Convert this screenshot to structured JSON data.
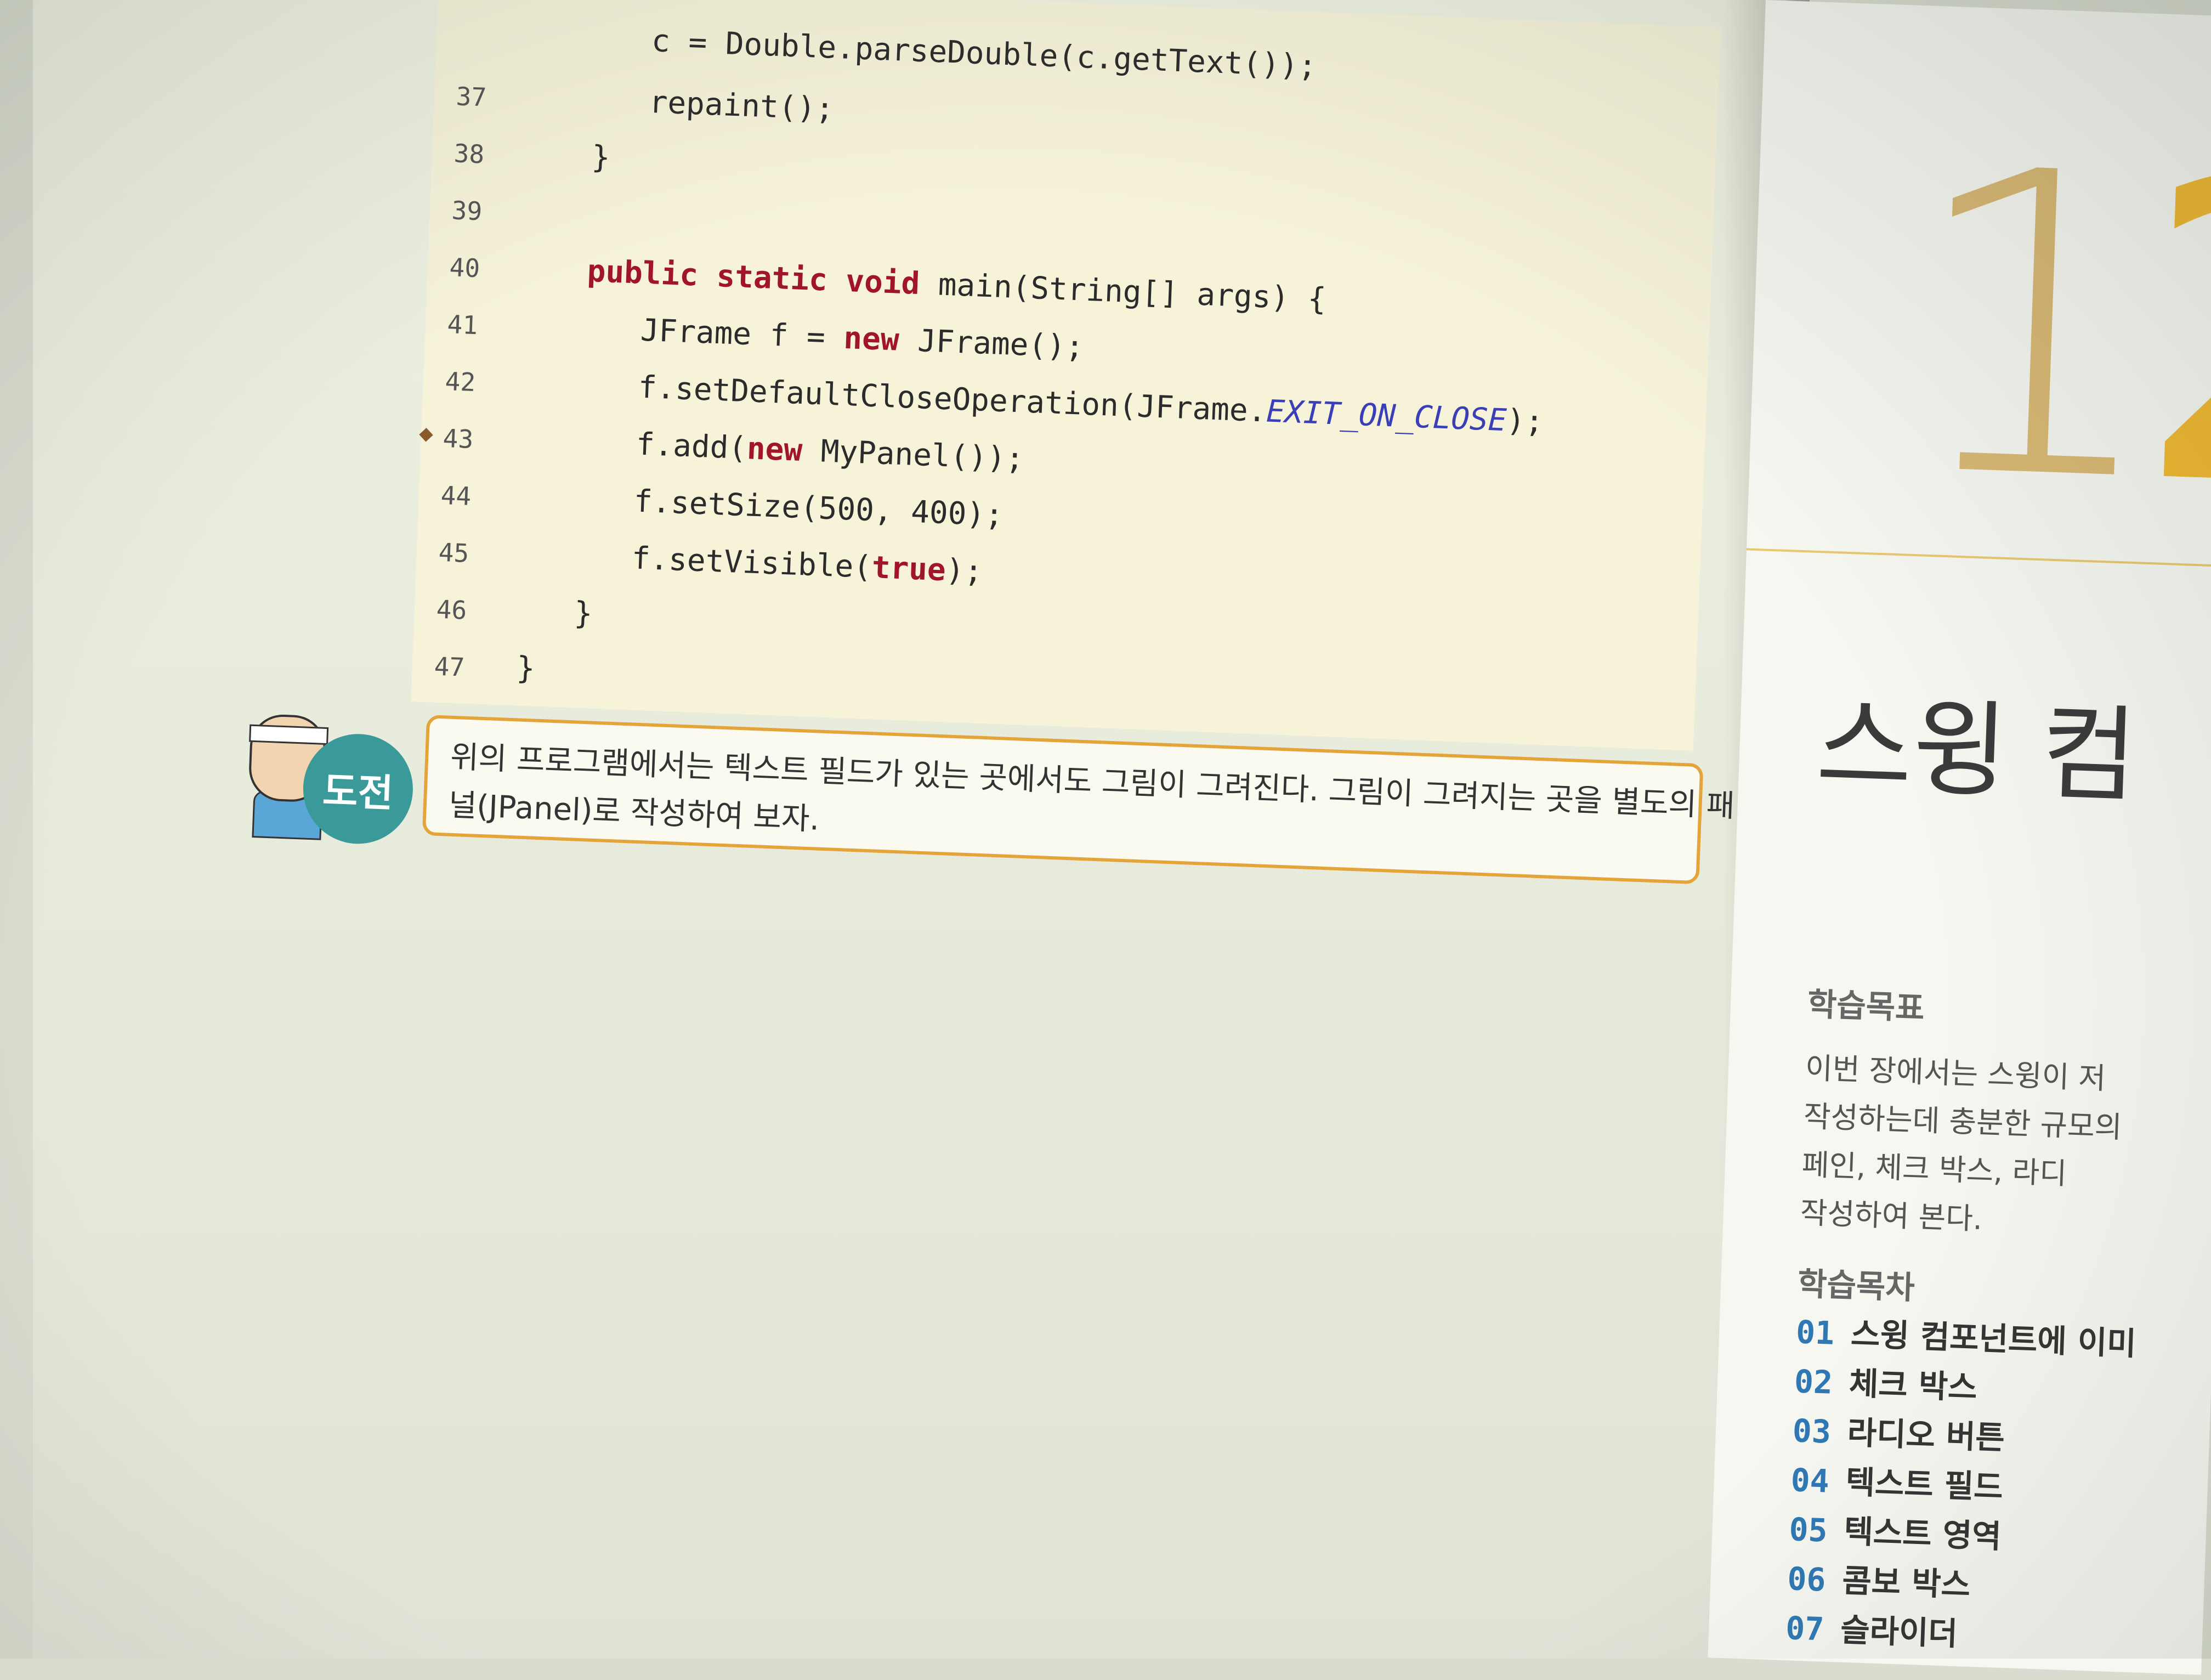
{
  "code": {
    "top_partial": "c = Double.parseDouble(c.getText());",
    "lines": [
      {
        "n": "37",
        "indent": "      ",
        "parts": [
          {
            "t": "repaint();",
            "c": ""
          }
        ]
      },
      {
        "n": "38",
        "indent": "   ",
        "parts": [
          {
            "t": "}",
            "c": ""
          }
        ]
      },
      {
        "n": "39",
        "indent": "",
        "parts": []
      },
      {
        "n": "40",
        "indent": "   ",
        "parts": [
          {
            "t": "public static void",
            "c": "kw"
          },
          {
            "t": " main(String[] args) {",
            "c": ""
          }
        ]
      },
      {
        "n": "41",
        "indent": "      ",
        "parts": [
          {
            "t": "JFrame f = ",
            "c": ""
          },
          {
            "t": "new",
            "c": "kw"
          },
          {
            "t": " JFrame();",
            "c": ""
          }
        ]
      },
      {
        "n": "42",
        "indent": "      ",
        "parts": [
          {
            "t": "f.setDefaultCloseOperation(JFrame.",
            "c": ""
          },
          {
            "t": "EXIT_ON_CLOSE",
            "c": "fld"
          },
          {
            "t": ");",
            "c": ""
          }
        ]
      },
      {
        "n": "43",
        "indent": "      ",
        "parts": [
          {
            "t": "f.add(",
            "c": ""
          },
          {
            "t": "new",
            "c": "kw"
          },
          {
            "t": " MyPanel());",
            "c": ""
          }
        ],
        "breakpoint": true
      },
      {
        "n": "44",
        "indent": "      ",
        "parts": [
          {
            "t": "f.setSize(500, 400);",
            "c": ""
          }
        ]
      },
      {
        "n": "45",
        "indent": "      ",
        "parts": [
          {
            "t": "f.setVisible(",
            "c": ""
          },
          {
            "t": "true",
            "c": "kw"
          },
          {
            "t": ");",
            "c": ""
          }
        ]
      },
      {
        "n": "46",
        "indent": "   ",
        "parts": [
          {
            "t": "}",
            "c": ""
          }
        ]
      },
      {
        "n": "47",
        "indent": "",
        "parts": [
          {
            "t": "}",
            "c": ""
          }
        ]
      }
    ]
  },
  "challenge": {
    "badge": "도전",
    "text_line1": "위의 프로그램에서는 텍스트 필드가 있는 곳에서도 그림이 그려진다. 그림이 그려지는 곳을 별도의 패",
    "text_line2": "널(JPanel)로 작성하여 보자."
  },
  "right_page": {
    "chapter_number": "1",
    "chapter_number_partial": "2",
    "chapter_title": "스윙 컴",
    "objectives_heading": "학습목표",
    "objectives_text": "이번 장에서는 스윙이 저\n작성하는데 충분한 규모의\n페인, 체크 박스, 라디\n작성하여 본다.",
    "toc_heading": "학습목차",
    "toc": [
      {
        "num": "01",
        "title": "스윙 컴포넌트에 이미"
      },
      {
        "num": "02",
        "title": "체크 박스"
      },
      {
        "num": "03",
        "title": "라디오 버튼"
      },
      {
        "num": "04",
        "title": "텍스트 필드"
      },
      {
        "num": "05",
        "title": "텍스트 영역"
      },
      {
        "num": "06",
        "title": "콤보 박스"
      },
      {
        "num": "07",
        "title": "슬라이더"
      }
    ]
  },
  "colors": {
    "keyword": "#a0152a",
    "constant": "#3a3fb8",
    "toc_number": "#2f78b4",
    "challenge_border": "#e4a43a",
    "badge": "#3a9a9a"
  }
}
